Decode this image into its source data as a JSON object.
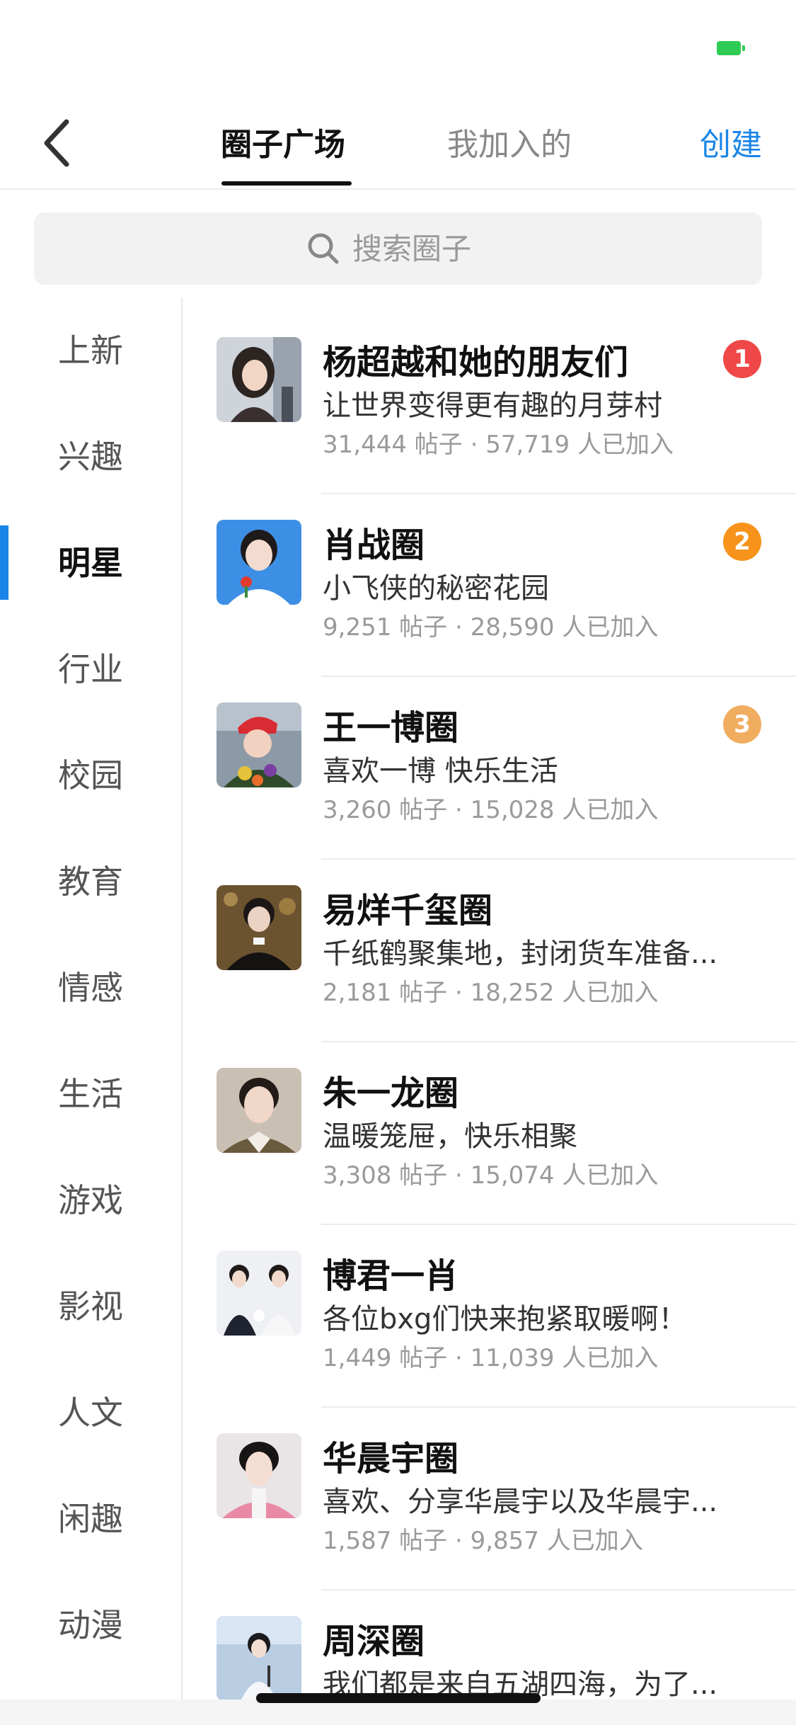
{
  "status_bar": {
    "battery_color": "#2ecc55"
  },
  "header": {
    "tabs": [
      {
        "label": "圈子广场",
        "active": true
      },
      {
        "label": "我加入的",
        "active": false
      }
    ],
    "create_label": "创建"
  },
  "search": {
    "placeholder": "搜索圈子"
  },
  "categories": {
    "items": [
      "上新",
      "兴趣",
      "明星",
      "行业",
      "校园",
      "教育",
      "情感",
      "生活",
      "游戏",
      "影视",
      "人文",
      "闲趣",
      "动漫"
    ],
    "active": "明星"
  },
  "circles": [
    {
      "name": "杨超越和她的朋友们",
      "desc": "让世界变得更有趣的月芽村",
      "stats": "31,444 帖子 · 57,719 人已加入",
      "rank": "1",
      "rank_color": "#f04848"
    },
    {
      "name": "肖战圈",
      "desc": "小飞侠的秘密花园",
      "stats": "9,251 帖子 · 28,590 人已加入",
      "rank": "2",
      "rank_color": "#f7931a"
    },
    {
      "name": "王一博圈",
      "desc": "喜欢一博 快乐生活",
      "stats": "3,260 帖子 · 15,028 人已加入",
      "rank": "3",
      "rank_color": "#f0ad60"
    },
    {
      "name": "易烊千玺圈",
      "desc": "千纸鹤聚集地，封闭货车准备...",
      "stats": "2,181 帖子 · 18,252 人已加入"
    },
    {
      "name": "朱一龙圈",
      "desc": "温暖笼屉，快乐相聚",
      "stats": "3,308 帖子 · 15,074 人已加入"
    },
    {
      "name": "博君一肖",
      "desc": "各位bxg们快来抱紧取暖啊！",
      "stats": "1,449 帖子 · 11,039 人已加入"
    },
    {
      "name": "华晨宇圈",
      "desc": "喜欢、分享华晨宇以及华晨宇...",
      "stats": "1,587 帖子 · 9,857 人已加入"
    },
    {
      "name": "周深圈",
      "desc": "我们都是来自五湖四海，为了...",
      "stats": ""
    }
  ]
}
